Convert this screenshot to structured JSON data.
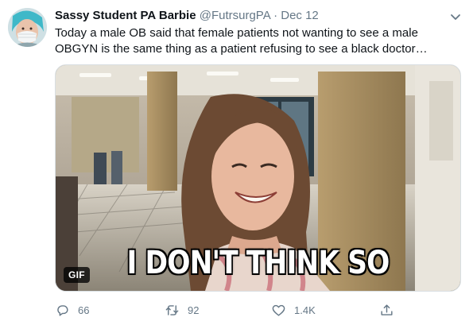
{
  "tweet": {
    "display_name": "Sassy Student PA Barbie",
    "handle": "@FutrsurgPA",
    "separator": "·",
    "date": "Dec 12",
    "text": "Today a male OB said that female patients not wanting to see a male OBGYN is the same thing as a patient refusing to see a black doctor…"
  },
  "media": {
    "badge": "GIF",
    "caption": "I DON'T THINK SO"
  },
  "actions": {
    "reply_count": "66",
    "retweet_count": "92",
    "like_count": "1.4K"
  },
  "icons": {
    "caret": "chevron-down-icon",
    "reply": "reply-icon",
    "retweet": "retweet-icon",
    "like": "heart-icon",
    "share": "share-icon"
  },
  "colors": {
    "text": "#0f1419",
    "secondary": "#657786"
  }
}
